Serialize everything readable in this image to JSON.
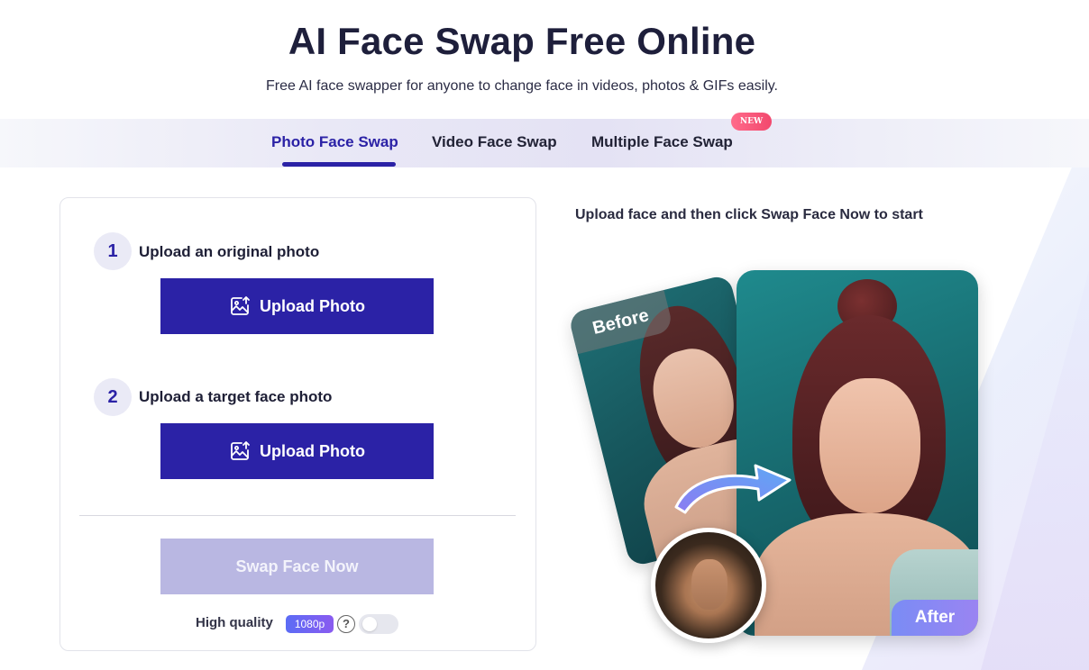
{
  "hero": {
    "title": "AI Face Swap Free Online",
    "subtitle": "Free AI face swapper for anyone to change face in videos, photos & GIFs easily."
  },
  "tabs": [
    {
      "label": "Photo Face Swap",
      "active": true
    },
    {
      "label": "Video Face Swap",
      "active": false
    },
    {
      "label": "Multiple Face Swap",
      "active": false,
      "badge": "NEW"
    }
  ],
  "steps": [
    {
      "number": "1",
      "label": "Upload an original photo",
      "button": "Upload Photo"
    },
    {
      "number": "2",
      "label": "Upload a target face photo",
      "button": "Upload Photo"
    }
  ],
  "swap_button": "Swap Face Now",
  "quality": {
    "label": "High quality",
    "badge": "1080p",
    "help": "?",
    "enabled": false
  },
  "preview": {
    "caption": "Upload face and then click Swap Face Now to start",
    "before_label": "Before",
    "after_label": "After"
  },
  "colors": {
    "primary": "#2b22a6",
    "disabled": "#b9b7e2",
    "new_badge": "#f2486d"
  }
}
